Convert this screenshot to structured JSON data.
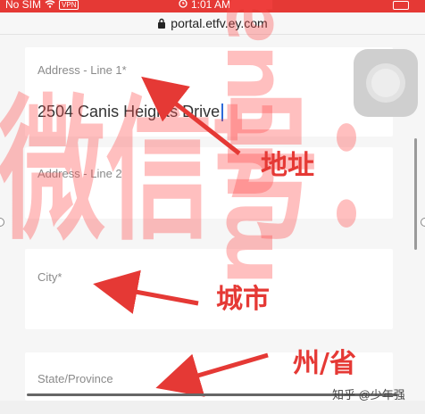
{
  "status_bar": {
    "carrier": "No SIM",
    "vpn": "VPN",
    "time": "1:01 AM"
  },
  "browser": {
    "url": "portal.etfv.ey.com"
  },
  "form": {
    "address_line1": {
      "label": "Address - Line 1*",
      "value": "2504 Canis Heights Drive"
    },
    "address_line2": {
      "label": "Address - Line 2"
    },
    "city": {
      "label": "City*"
    },
    "state": {
      "label": "State/Province"
    }
  },
  "annotations": {
    "address": "地址",
    "city": "城市",
    "state": "州/省"
  },
  "watermark": {
    "chinese": "微信号：",
    "latin": "mutuanide"
  },
  "credit": "知乎 @少年强",
  "colors": {
    "status_bar": "#e53935",
    "annotation_red": "#e53935",
    "cursor": "#2e6bd9"
  }
}
